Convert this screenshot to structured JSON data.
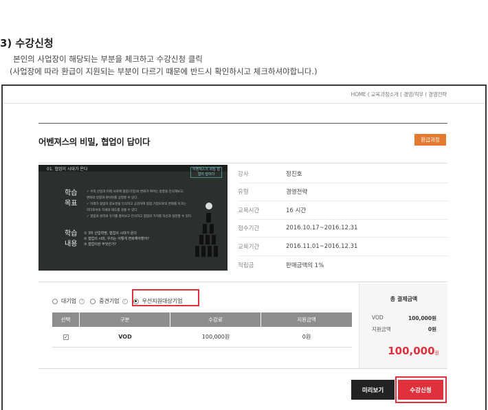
{
  "instructions": {
    "title": "3) 수강신청",
    "line1": "본인의 사업장이 해당되는 부분을 체크하고 수강신청 클릭",
    "line2": "(사업장에 따라 환급이 지원되는 부분이 다르기 때문에 반드시 확인하시고 체크하셔야합니다.)"
  },
  "breadcrumb": "HOME ( 교육과정소개 ( 경영/직무 ( 경영전략",
  "course": {
    "title": "어벤져스의 비밀, 협업이 답이다",
    "badge": "환급과정",
    "thumbnail": {
      "header": "01. 협업이 시대가 온다",
      "brand": "어벤져스의 비밀 협업이 답이다",
      "heading1": "학습\n목표",
      "heading2": "학습\n내용",
      "goals": [
        "✓ 우리 산업과 미래 사회에 협업(기업)의 변화가 여겨는 방향을 인식해보고,",
        "   변화의 방향과 준비된를 상정할 수 있다.",
        "✓ 미래가 협업이 중요성을 인식하고 공감하여 협업 기업으로의 변화를 이끄는",
        "   리더로서의 자세와 태도를 갖출 수 있다.",
        "✓ 협업의 원리와 유기를 총아보고 인식하고 협업의 가치를 자신과 실천할 수 있다."
      ],
      "contents": [
        "① 3차 산업혁명, 협업의 시대가 온다",
        "② 협업의 시대, 우리는 어떻게 변화해야할까?",
        "③ 협업이란 무엇인가?"
      ]
    },
    "info": [
      {
        "label": "강사",
        "value": "정진호"
      },
      {
        "label": "유형",
        "value": "경영전략"
      },
      {
        "label": "교육시간",
        "value": "16 시간"
      },
      {
        "label": "접수기간",
        "value": "2016.10.17~2016.12.31"
      },
      {
        "label": "교육기간",
        "value": "2016.11.01~2016.12.31"
      },
      {
        "label": "적립금",
        "value": "판매금액의 1%"
      }
    ]
  },
  "company_types": [
    {
      "label": "대기업",
      "selected": false
    },
    {
      "label": "중견기업",
      "selected": false
    },
    {
      "label": "우선지원대상기업",
      "selected": true
    }
  ],
  "table": {
    "headers": [
      "선택",
      "구분",
      "수강료",
      "지원금액"
    ],
    "rows": [
      {
        "checked": true,
        "type": "VOD",
        "fee": "100,000원",
        "support": "0원"
      }
    ]
  },
  "summary": {
    "title": "총 결제금액",
    "vod_label": "VOD",
    "vod_value": "100,000원",
    "support_label": "지원금액",
    "support_value": "0원",
    "total": "100,000",
    "unit": "원"
  },
  "buttons": {
    "preview": "미리보기",
    "apply": "수강신청"
  },
  "colors": {
    "accent": "#e0303c",
    "badge": "#e47a30",
    "table_header": "#8d8d8d"
  }
}
